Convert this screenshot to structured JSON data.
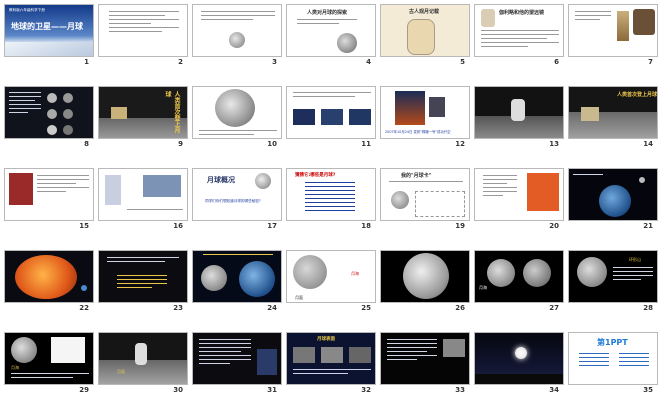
{
  "slides": [
    {
      "num": "1",
      "title": "地球的卫星——月球",
      "subtitle": "教科版六年级科学下册"
    },
    {
      "num": "2"
    },
    {
      "num": "3"
    },
    {
      "num": "4",
      "title": "人类对月球的探索"
    },
    {
      "num": "5",
      "title": "古人观月记载"
    },
    {
      "num": "6",
      "title": "伽利略和他的望远镜"
    },
    {
      "num": "7"
    },
    {
      "num": "8"
    },
    {
      "num": "9",
      "title": "人类首次登上月球"
    },
    {
      "num": "10"
    },
    {
      "num": "11"
    },
    {
      "num": "12",
      "caption": "2007年10月24日 发射\"嫦娥一号\"成功升空"
    },
    {
      "num": "13"
    },
    {
      "num": "14",
      "title": "人类首次登上月球"
    },
    {
      "num": "15"
    },
    {
      "num": "16"
    },
    {
      "num": "17",
      "title": "月球概况",
      "caption": "同学们你们想知道月球的哪些秘密?"
    },
    {
      "num": "18",
      "title": "猜猜它:哪些是月球?"
    },
    {
      "num": "19",
      "title": "我的\"月球卡\""
    },
    {
      "num": "20"
    },
    {
      "num": "21"
    },
    {
      "num": "22"
    },
    {
      "num": "23"
    },
    {
      "num": "24"
    },
    {
      "num": "25",
      "label_a": "月面",
      "label_b": "月海"
    },
    {
      "num": "26"
    },
    {
      "num": "27",
      "label_a": "月海"
    },
    {
      "num": "28",
      "label_a": "环形山"
    },
    {
      "num": "29",
      "label_a": "月海"
    },
    {
      "num": "30",
      "label_a": "月面"
    },
    {
      "num": "31"
    },
    {
      "num": "32",
      "title": "月球表面"
    },
    {
      "num": "33"
    },
    {
      "num": "34"
    },
    {
      "num": "35",
      "logo": "第1PPT"
    }
  ],
  "colors": {
    "border": "#b9b9b9",
    "dark_bg": "#0a0a12",
    "night_blue": "#1a2447",
    "accent_red": "#cc0000",
    "link_blue": "#2040a0"
  }
}
